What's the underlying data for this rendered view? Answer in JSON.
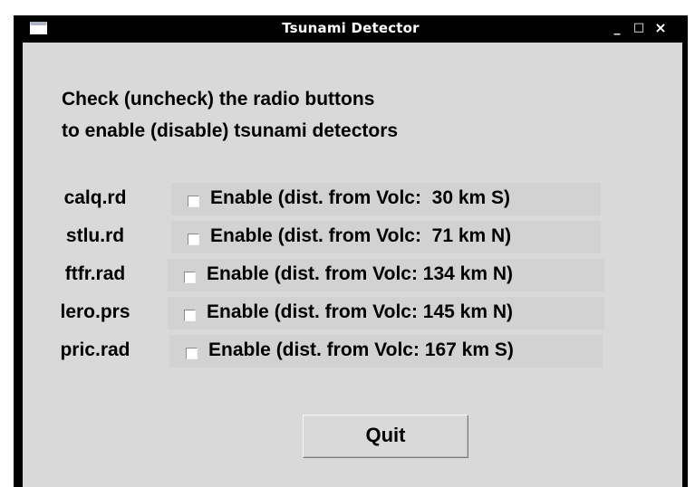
{
  "window": {
    "title": "Tsunami Detector",
    "controls": {
      "minimize": "_",
      "maximize": "□",
      "close": "×"
    }
  },
  "instructions": {
    "line1": "Check (uncheck) the radio buttons",
    "line2": "to enable (disable) tsunami detectors"
  },
  "detectors": [
    {
      "name": "calq.rd",
      "checked": false,
      "label": "Enable (dist. from Volc:  30 km S)"
    },
    {
      "name": "stlu.rd",
      "checked": false,
      "label": "Enable (dist. from Volc:  71 km N)"
    },
    {
      "name": "ftfr.rad",
      "checked": false,
      "label": "Enable (dist. from Volc: 134 km N)"
    },
    {
      "name": "lero.prs",
      "checked": false,
      "label": "Enable (dist. from Volc: 145 km N)"
    },
    {
      "name": "pric.rad",
      "checked": false,
      "label": "Enable (dist. from Volc: 167 km S)"
    }
  ],
  "quit_label": "Quit"
}
